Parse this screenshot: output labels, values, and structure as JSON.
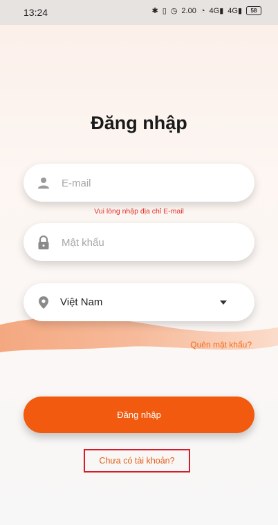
{
  "status_bar": {
    "time": "13:24",
    "speed": "2.00",
    "battery": "58",
    "net1": "4G",
    "net2": "4G"
  },
  "login": {
    "title": "Đăng nhập",
    "email_placeholder": "E-mail",
    "email_error": "Vui lòng nhập địa chỉ E-mail",
    "password_placeholder": "Mật khẩu",
    "country_value": "Việt Nam",
    "forgot_password": "Quên mật khẩu?",
    "submit_label": "Đăng nhập",
    "signup_link": "Chưa có tài khoản?"
  },
  "colors": {
    "accent": "#f15a0f",
    "error": "#e3312a",
    "highlight_border": "#d71b2a"
  },
  "icons": {
    "email": "user-icon",
    "password": "lock-icon",
    "country": "location-pin-icon",
    "dropdown": "caret-down-icon"
  }
}
